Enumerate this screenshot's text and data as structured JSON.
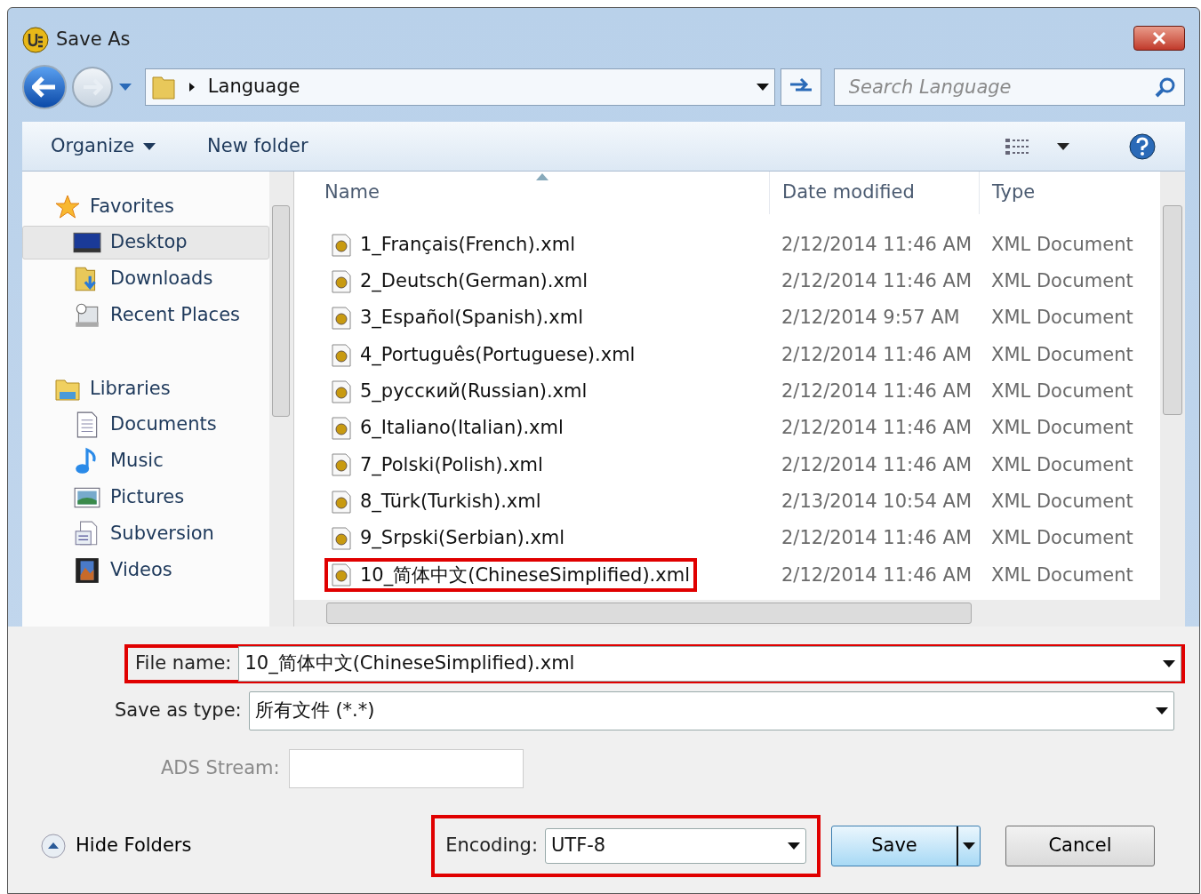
{
  "window": {
    "title": "Save As"
  },
  "address_bar": {
    "path": [
      "Language"
    ]
  },
  "search": {
    "placeholder": "Search Language"
  },
  "toolbar": {
    "buttons": [
      {
        "label": "Organize",
        "has_menu": true
      },
      {
        "label": "New folder",
        "has_menu": false
      }
    ]
  },
  "nav": {
    "groups": [
      {
        "label": "Favorites",
        "kind": "star",
        "children": [
          {
            "label": "Desktop",
            "kind": "desktop",
            "selected": true
          },
          {
            "label": "Downloads",
            "kind": "downloads",
            "selected": false
          },
          {
            "label": "Recent Places",
            "kind": "recent",
            "selected": false
          }
        ]
      },
      {
        "label": "Libraries",
        "kind": "library",
        "children": [
          {
            "label": "Documents",
            "kind": "documents",
            "selected": false
          },
          {
            "label": "Music",
            "kind": "music",
            "selected": false
          },
          {
            "label": "Pictures",
            "kind": "pictures",
            "selected": false
          },
          {
            "label": "Subversion",
            "kind": "subversion",
            "selected": false
          },
          {
            "label": "Videos",
            "kind": "videos",
            "selected": false
          }
        ]
      }
    ]
  },
  "file_list": {
    "columns": [
      "Name",
      "Date modified",
      "Type"
    ],
    "rows": [
      {
        "name": "1_Français(French).xml",
        "date": "2/12/2014 11:46 AM",
        "type": "XML Document",
        "highlighted": false
      },
      {
        "name": "2_Deutsch(German).xml",
        "date": "2/12/2014 11:46 AM",
        "type": "XML Document",
        "highlighted": false
      },
      {
        "name": "3_Español(Spanish).xml",
        "date": "2/12/2014 9:57 AM",
        "type": "XML Document",
        "highlighted": false
      },
      {
        "name": "4_Português(Portuguese).xml",
        "date": "2/12/2014 11:46 AM",
        "type": "XML Document",
        "highlighted": false
      },
      {
        "name": "5_русский(Russian).xml",
        "date": "2/12/2014 11:46 AM",
        "type": "XML Document",
        "highlighted": false
      },
      {
        "name": "6_Italiano(Italian).xml",
        "date": "2/12/2014 11:46 AM",
        "type": "XML Document",
        "highlighted": false
      },
      {
        "name": "7_Polski(Polish).xml",
        "date": "2/12/2014 11:46 AM",
        "type": "XML Document",
        "highlighted": false
      },
      {
        "name": "8_Türk(Turkish).xml",
        "date": "2/13/2014 10:54 AM",
        "type": "XML Document",
        "highlighted": false
      },
      {
        "name": "9_Srpski(Serbian).xml",
        "date": "2/12/2014 11:46 AM",
        "type": "XML Document",
        "highlighted": false
      },
      {
        "name": "10_简体中文(ChineseSimplified).xml",
        "date": "2/12/2014 11:46 AM",
        "type": "XML Document",
        "highlighted": true
      }
    ]
  },
  "form": {
    "file_name": {
      "label": "File name:",
      "value": "10_简体中文(ChineseSimplified).xml",
      "highlighted": true
    },
    "save_as_type": {
      "label": "Save as type:",
      "value": "所有文件 (*.*)"
    },
    "ads_stream": {
      "label": "ADS Stream:",
      "disabled": true
    },
    "encoding": {
      "label": "Encoding:",
      "value": "UTF-8",
      "highlighted": true
    }
  },
  "hide_folders": {
    "label": "Hide Folders"
  },
  "buttons": [
    {
      "label": "Save",
      "kind": "split"
    },
    {
      "label": "Cancel",
      "kind": "plain"
    }
  ]
}
